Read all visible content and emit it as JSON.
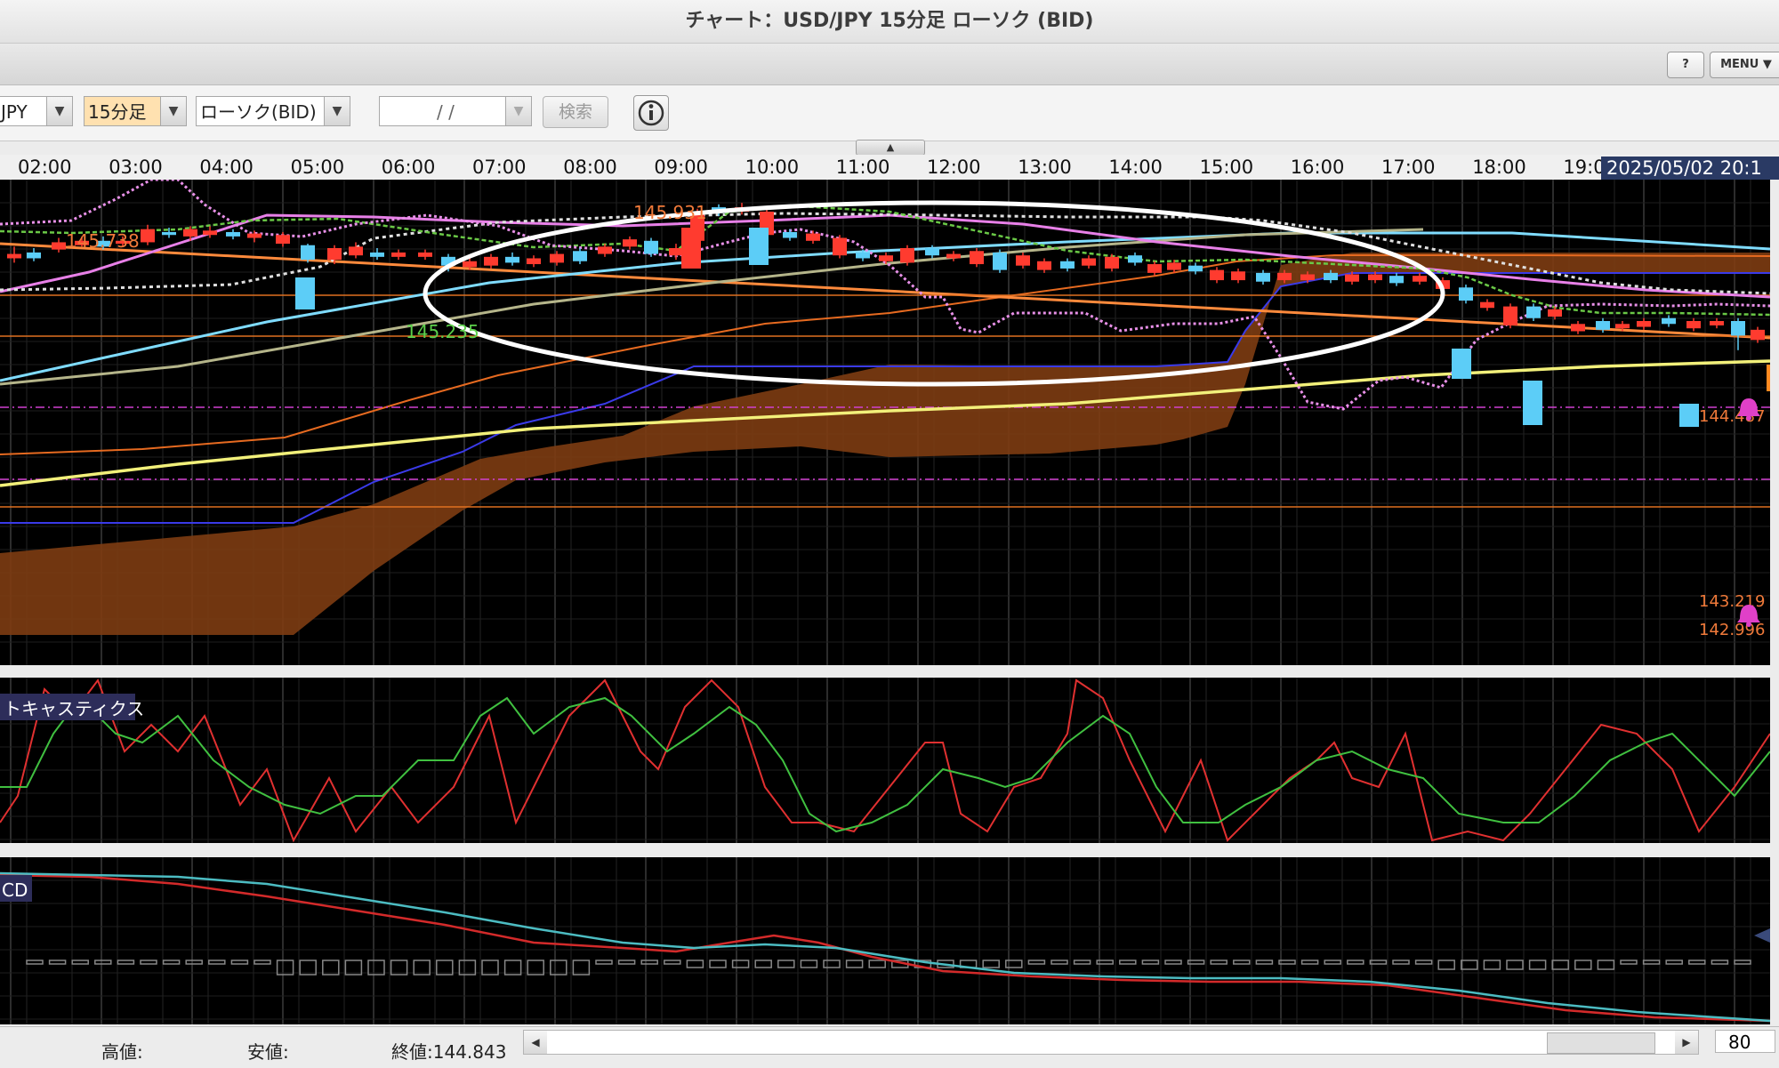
{
  "window": {
    "title": "チャート：USD/JPY 15分足 ローソク (BID)"
  },
  "menu": {
    "help_label": "?",
    "menu_label": "MENU ▼"
  },
  "toolbar": {
    "symbol": "JPY",
    "timeframe": "15分足",
    "chart_type": "ローソク(BID)",
    "date_value": "/   /",
    "search_label": "検索",
    "dropdown_arrow": "▼"
  },
  "time_axis": {
    "labels": [
      "02:00",
      "03:00",
      "04:00",
      "05:00",
      "06:00",
      "07:00",
      "08:00",
      "09:00",
      "10:00",
      "11:00",
      "12:00",
      "13:00",
      "14:00",
      "15:00",
      "16:00",
      "17:00",
      "18:00",
      "19:0"
    ],
    "current_datetime": "2025/05/02 20:1"
  },
  "price_labels": {
    "high_left": "145.738",
    "high_peak": "145.931",
    "low_mark": "145.235",
    "right_current": "144.487",
    "right_low1": "143.219",
    "right_low2": "142.996"
  },
  "panels": {
    "stochastics_label": "トキャスティクス",
    "macd_label": "CD"
  },
  "status": {
    "high_label": "高値:",
    "low_label": "安値:",
    "close_label": "終値:144.843",
    "zoom_value": "80"
  },
  "colors": {
    "up_candle": "#ff3b2f",
    "down_candle": "#5ccdf7",
    "cloud": "#8b4315",
    "annotation": "#ffffff",
    "stoch_k": "#e03030",
    "stoch_d": "#40c040"
  },
  "icons": {
    "info": "info-circle-icon",
    "collapse": "chevron-up-icon",
    "alert": "bell-alert-icon"
  }
}
